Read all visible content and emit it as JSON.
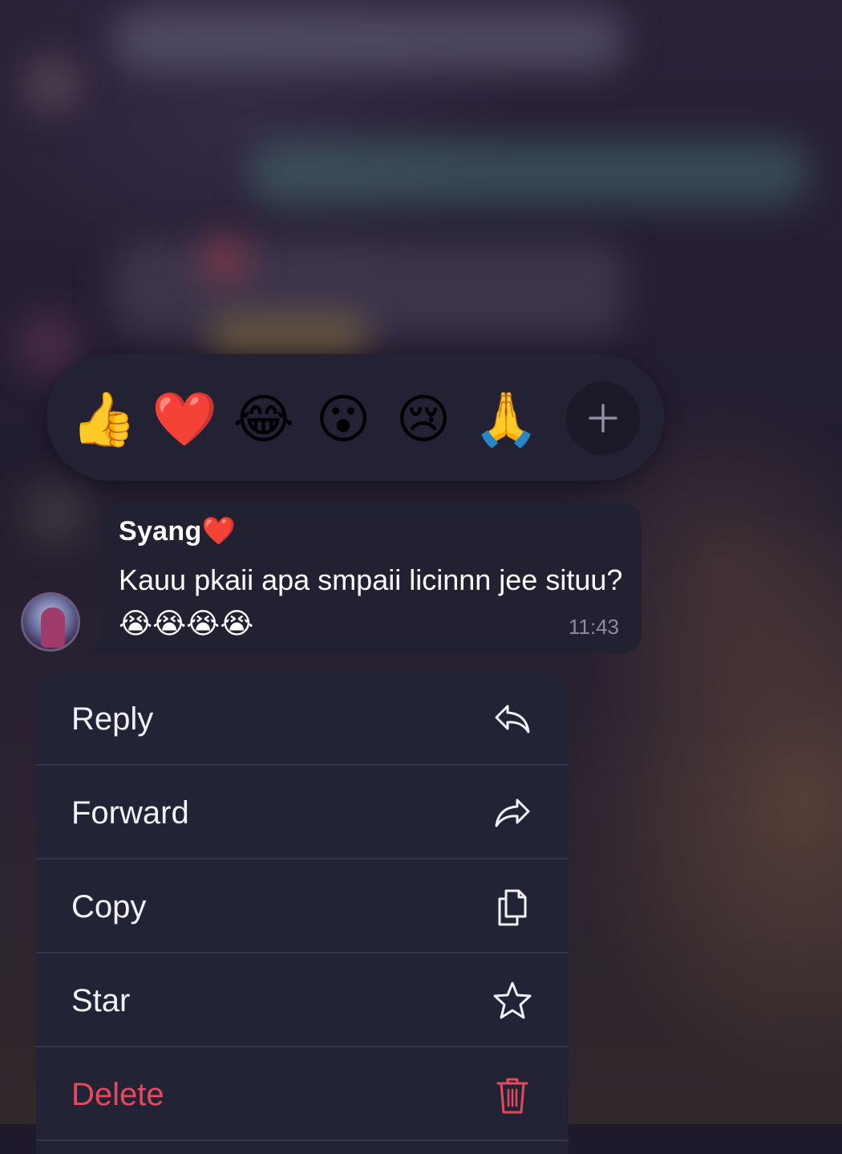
{
  "reactions": {
    "emojis": [
      {
        "icon": "thumbs-up",
        "glyph": "👍"
      },
      {
        "icon": "red-heart",
        "glyph": "❤️"
      },
      {
        "icon": "tears-of-joy",
        "glyph": "😂"
      },
      {
        "icon": "surprised-face",
        "glyph": "😮"
      },
      {
        "icon": "crying-face",
        "glyph": "😢"
      },
      {
        "icon": "folded-hands",
        "glyph": "🙏"
      }
    ],
    "more_icon": "plus-icon"
  },
  "message": {
    "sender": "Syang❤️",
    "text": "Kauu pkaii apa smpaii licinnn jee situu?😭😭😭😭",
    "time": "11:43"
  },
  "menu": {
    "reply_label": "Reply",
    "forward_label": "Forward",
    "copy_label": "Copy",
    "star_label": "Star",
    "delete_label": "Delete"
  },
  "colors": {
    "bubble": "#222132",
    "menu_bg": "#232336",
    "delete_red": "#e44a5e",
    "time_gray": "#8d8c9c"
  }
}
